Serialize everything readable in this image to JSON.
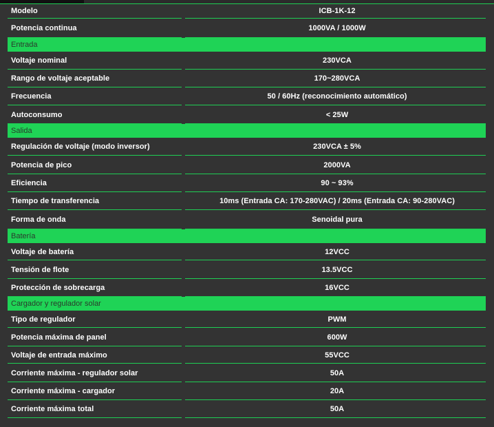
{
  "rows": [
    {
      "type": "row",
      "label": "Modelo",
      "value": "ICB-1K-12",
      "h": 23
    },
    {
      "type": "row",
      "label": "Potencia continua",
      "value": "1000VA / 1000W",
      "h": 28
    },
    {
      "type": "section",
      "label": "Entrada"
    },
    {
      "type": "row",
      "label": "Voltaje nominal",
      "value": "230VCA",
      "h": 26
    },
    {
      "type": "row",
      "label": "Rango de voltaje aceptable",
      "value": "170~280VCA",
      "h": 26
    },
    {
      "type": "row",
      "label": "Frecuencia",
      "value": "50 / 60Hz (reconocimiento automático)",
      "h": 26
    },
    {
      "type": "row",
      "label": "Autoconsumo",
      "value": "< 25W",
      "h": 27
    },
    {
      "type": "section",
      "label": "Salida"
    },
    {
      "type": "row",
      "label": "Regulación de voltaje (modo inversor)",
      "value": "230VCA ± 5%",
      "h": 26
    },
    {
      "type": "row",
      "label": "Potencia de pico",
      "value": "2000VA",
      "h": 27
    },
    {
      "type": "row",
      "label": "Eficiencia",
      "value": "90 ~ 93%",
      "h": 26
    },
    {
      "type": "row",
      "label": "Tiempo de transferencia",
      "value": "10ms (Entrada CA: 170-280VAC) / 20ms (Entrada CA: 90-280VAC)",
      "h": 26
    },
    {
      "type": "row",
      "label": "Forma de onda",
      "value": "Senoidal pura",
      "h": 28
    },
    {
      "type": "section",
      "label": "Batería"
    },
    {
      "type": "row",
      "label": "Voltaje de batería",
      "value": "12VCC",
      "h": 25
    },
    {
      "type": "row",
      "label": "Tensión de flote",
      "value": "13.5VCC",
      "h": 27
    },
    {
      "type": "row",
      "label": "Protección de sobrecarga",
      "value": "16VCC",
      "h": 26
    },
    {
      "type": "section",
      "label": "Cargador y regulador solar"
    },
    {
      "type": "row",
      "label": "Tipo de regulador",
      "value": "PWM",
      "h": 25
    },
    {
      "type": "row",
      "label": "Potencia máxima de panel",
      "value": "600W",
      "h": 27
    },
    {
      "type": "row",
      "label": "Voltaje de entrada máximo",
      "value": "55VCC",
      "h": 25
    },
    {
      "type": "row",
      "label": "Corriente máxima - regulador solar",
      "value": "50A",
      "h": 27
    },
    {
      "type": "row",
      "label": "Corriente máxima - cargador",
      "value": "20A",
      "h": 26
    },
    {
      "type": "row",
      "label": "Corriente máxima total",
      "value": "50A",
      "h": 26
    }
  ]
}
